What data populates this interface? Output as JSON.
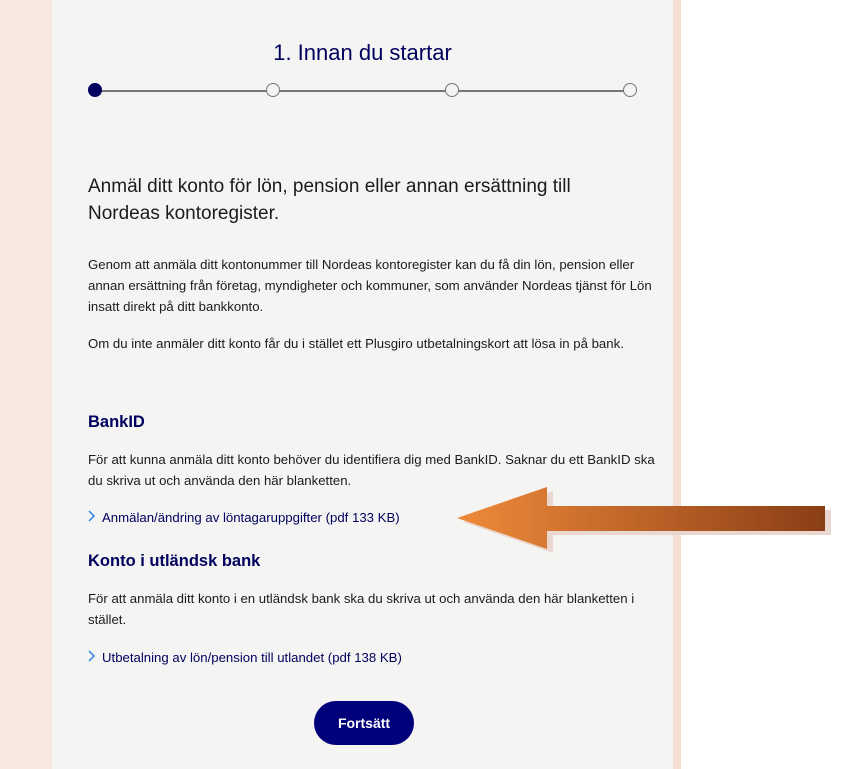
{
  "header": {
    "title": "1. Innan du startar"
  },
  "stepper": {
    "total_steps": 4,
    "current_step": 1
  },
  "intro": {
    "heading": "Anmäl ditt konto för lön, pension eller annan ersättning till Nordeas kontoregister.",
    "paragraph1": "Genom att anmäla ditt kontonummer till Nordeas kontoregister kan du få din lön, pension eller annan ersättning från företag, myndigheter och kommuner, som använder Nordeas tjänst för Lön insatt direkt på ditt bankkonto.",
    "paragraph2": "Om du inte anmäler ditt konto får du i stället ett Plusgiro utbetalningskort att lösa in på bank."
  },
  "bankid": {
    "heading": "BankID",
    "text": "För att kunna anmäla ditt konto behöver du identifiera dig med BankID. Saknar du ett BankID ska du skriva ut och använda den här blanketten.",
    "link": "Anmälan/ändring av löntagaruppgifter (pdf 133 KB)"
  },
  "foreign": {
    "heading": "Konto i utländsk bank",
    "text": "För att anmäla ditt konto i en utländsk bank ska du skriva ut och använda den här blanketten i stället.",
    "link": "Utbetalning av lön/pension till utlandet (pdf 138 KB)"
  },
  "actions": {
    "continue_label": "Fortsätt"
  },
  "colors": {
    "brand": "#00005e",
    "button": "#00007a",
    "link_chevron": "#2f7fe0",
    "card_bg": "#f4f4f3",
    "side_bg": "#f8e7df",
    "annotation_arrow": "#d9772c"
  },
  "icons": {
    "link": "chevron-right-icon",
    "annotation": "arrow-left-icon"
  }
}
